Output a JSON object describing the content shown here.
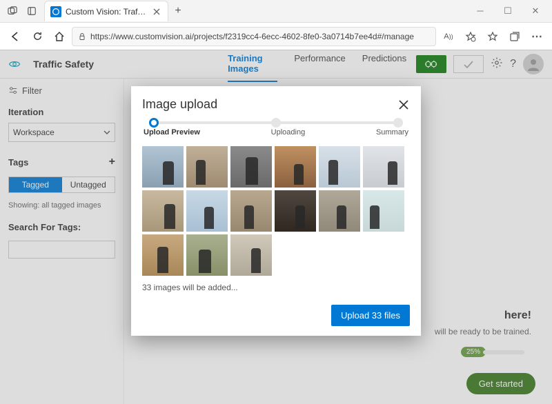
{
  "browser": {
    "tab_title": "Custom Vision: Traffic Safety - Tr",
    "url": "https://www.customvision.ai/projects/f2319cc4-6ecc-4602-8fe0-3a0714b7ee4d#/manage",
    "a_caps": "Aᴬ"
  },
  "app": {
    "project_title": "Traffic Safety",
    "tabs": {
      "training": "Training Images",
      "performance": "Performance",
      "predictions": "Predictions"
    }
  },
  "sidebar": {
    "filter_label": "Filter",
    "iteration_label": "Iteration",
    "iteration_value": "Workspace",
    "tags_label": "Tags",
    "tagged_label": "Tagged",
    "untagged_label": "Untagged",
    "showing_text": "Showing: all tagged images",
    "search_label": "Search For Tags:"
  },
  "background": {
    "headline_suffix": "here!",
    "subtext_suffix": "will be ready to be trained.",
    "progress_pct": "25%",
    "get_started": "Get started"
  },
  "modal": {
    "title": "Image upload",
    "step1": "Upload Preview",
    "step2": "Uploading",
    "step3": "Summary",
    "added_text": "33 images will be added...",
    "upload_button": "Upload 33 files",
    "thumbnails": [
      {
        "bg": "linear-gradient(#b0c4d4,#8aa0b0)",
        "pw": "16",
        "ph": "34",
        "pl": "30"
      },
      {
        "bg": "linear-gradient(#c0b098,#9e8a70)",
        "pw": "14",
        "ph": "36",
        "pl": "14"
      },
      {
        "bg": "linear-gradient(#8a8a8a,#6a6a6a)",
        "pw": "18",
        "ph": "40",
        "pl": "22"
      },
      {
        "bg": "linear-gradient(#c09060,#8a6040)",
        "pw": "14",
        "ph": "30",
        "pl": "28"
      },
      {
        "bg": "linear-gradient(#d8e0e8,#b8c8d4)",
        "pw": "14",
        "ph": "36",
        "pl": "14"
      },
      {
        "bg": "linear-gradient(#e0e4e8,#c8ccd0)",
        "pw": "14",
        "ph": "34",
        "pl": "36"
      },
      {
        "bg": "linear-gradient(#c8b8a0,#a89878)",
        "pw": "16",
        "ph": "36",
        "pl": "32"
      },
      {
        "bg": "linear-gradient(#c8d8e4,#a8c0d4)",
        "pw": "14",
        "ph": "32",
        "pl": "26"
      },
      {
        "bg": "linear-gradient(#b8a890,#988870)",
        "pw": "14",
        "ph": "34",
        "pl": "20"
      },
      {
        "bg": "linear-gradient(#504840,#302820)",
        "pw": "14",
        "ph": "34",
        "pl": "30"
      },
      {
        "bg": "linear-gradient(#b0a898,#908878)",
        "pw": "14",
        "ph": "34",
        "pl": "26"
      },
      {
        "bg": "linear-gradient(#d8e8e8,#c8d8d8)",
        "pw": "14",
        "ph": "34",
        "pl": "10"
      },
      {
        "bg": "linear-gradient(#c8a880,#a88858)",
        "pw": "16",
        "ph": "38",
        "pl": "22"
      },
      {
        "bg": "linear-gradient(#a8b090,#889068)",
        "pw": "18",
        "ph": "34",
        "pl": "18"
      },
      {
        "bg": "linear-gradient(#d0c8b8,#b0a898)",
        "pw": "14",
        "ph": "36",
        "pl": "30"
      }
    ]
  }
}
